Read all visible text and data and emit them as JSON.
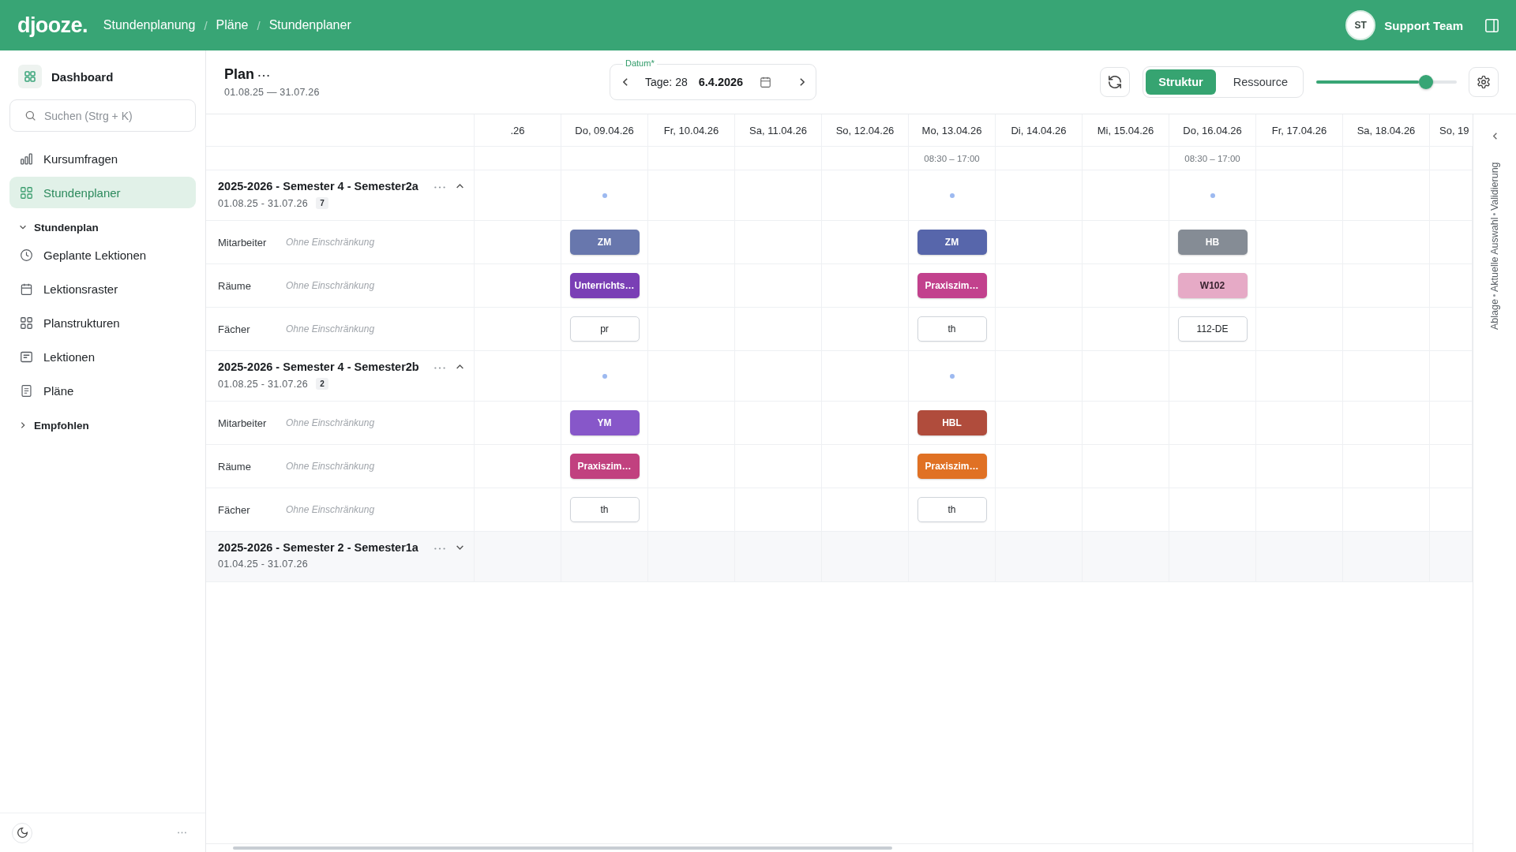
{
  "topbar": {
    "logo": "djooze.",
    "breadcrumb": [
      "Stundenplanung",
      "Pläne",
      "Stundenplaner"
    ],
    "separator": "/",
    "user": {
      "initials": "ST",
      "name": "Support Team"
    }
  },
  "sidebar": {
    "dashboard": "Dashboard",
    "search": {
      "placeholder": "Suchen (Strg + K)"
    },
    "items": [
      {
        "label": "Kursumfragen",
        "selected": false
      },
      {
        "label": "Stundenplaner",
        "selected": true
      }
    ],
    "sections": [
      {
        "label": "Stundenplan",
        "expanded": true,
        "children": [
          {
            "label": "Geplante Lektionen",
            "selected": false
          },
          {
            "label": "Lektionsraster",
            "selected": false
          },
          {
            "label": "Planstrukturen",
            "selected": false
          },
          {
            "label": "Lektionen",
            "selected": false
          },
          {
            "label": "Pläne",
            "selected": false
          }
        ]
      },
      {
        "label": "Empfohlen",
        "expanded": false
      }
    ]
  },
  "plan": {
    "title": "Plan",
    "dates": "01.08.25 — 31.07.26"
  },
  "date_picker": {
    "label": "Datum*",
    "days": "Tage: 28",
    "value": "6.4.2026"
  },
  "view_toggle": [
    {
      "label": "Struktur",
      "selected": true
    },
    {
      "label": "Ressource",
      "selected": false
    }
  ],
  "zoom_slider": {
    "level": 0.78
  },
  "grid": {
    "columns": [
      {
        "label": ".26"
      },
      {
        "label": "Do, 09.04.26"
      },
      {
        "label": "Fr, 10.04.26"
      },
      {
        "label": "Sa, 11.04.26"
      },
      {
        "label": "So, 12.04.26"
      },
      {
        "label": "Mo, 13.04.26",
        "hours": "08:30 – 17:00"
      },
      {
        "label": "Di, 14.04.26"
      },
      {
        "label": "Mi, 15.04.26"
      },
      {
        "label": "Do, 16.04.26",
        "hours": "08:30 – 17:00"
      },
      {
        "label": "Fr, 17.04.26"
      },
      {
        "label": "Sa, 18.04.26"
      },
      {
        "label": "So, 19"
      }
    ],
    "groups": [
      {
        "title": "2025-2026 - Semester 4 - Semester2a",
        "dates": "01.08.25 - 31.07.26",
        "count": "7",
        "expanded": true,
        "dots": [
          false,
          true,
          false,
          false,
          false,
          true,
          false,
          false,
          true,
          false,
          false,
          false
        ],
        "rows": [
          {
            "label": "Mitarbeiter",
            "filter": "Ohne Einschränkung",
            "cells": [
              null,
              {
                "kind": "filled",
                "text": "ZM",
                "color": "#6877ad"
              },
              null,
              null,
              null,
              {
                "kind": "filled",
                "text": "ZM",
                "color": "#5766ab"
              },
              null,
              null,
              {
                "kind": "filled",
                "text": "HB",
                "color": "#858c95"
              },
              null,
              null,
              null
            ]
          },
          {
            "label": "Räume",
            "filter": "Ohne Einschränkung",
            "cells": [
              null,
              {
                "kind": "filled",
                "text": "Unterrichts…",
                "color": "#7a3fb5"
              },
              null,
              null,
              null,
              {
                "kind": "filled",
                "text": "Praxiszim…",
                "color": "#c2418d"
              },
              null,
              null,
              {
                "kind": "filled",
                "text": "W102",
                "color": "#e6aac6"
              },
              null,
              null,
              null
            ]
          },
          {
            "label": "Fächer",
            "filter": "Ohne Einschränkung",
            "cells": [
              null,
              {
                "kind": "outline",
                "text": "pr"
              },
              null,
              null,
              null,
              {
                "kind": "outline",
                "text": "th"
              },
              null,
              null,
              {
                "kind": "outline",
                "text": "112-DE"
              },
              null,
              null,
              null
            ]
          }
        ]
      },
      {
        "title": "2025-2026 - Semester 4 - Semester2b",
        "dates": "01.08.25 - 31.07.26",
        "count": "2",
        "expanded": true,
        "dots": [
          false,
          true,
          false,
          false,
          false,
          true,
          false,
          false,
          false,
          false,
          false,
          false
        ],
        "rows": [
          {
            "label": "Mitarbeiter",
            "filter": "Ohne Einschränkung",
            "cells": [
              null,
              {
                "kind": "filled",
                "text": "YM",
                "color": "#8757c9"
              },
              null,
              null,
              null,
              {
                "kind": "filled",
                "text": "HBL",
                "color": "#b04c3c"
              },
              null,
              null,
              null,
              null,
              null,
              null
            ]
          },
          {
            "label": "Räume",
            "filter": "Ohne Einschränkung",
            "cells": [
              null,
              {
                "kind": "filled",
                "text": "Praxiszim…",
                "color": "#c1417f"
              },
              null,
              null,
              null,
              {
                "kind": "filled",
                "text": "Praxiszim…",
                "color": "#e07124"
              },
              null,
              null,
              null,
              null,
              null,
              null
            ]
          },
          {
            "label": "Fächer",
            "filter": "Ohne Einschränkung",
            "cells": [
              null,
              {
                "kind": "outline",
                "text": "th"
              },
              null,
              null,
              null,
              {
                "kind": "outline",
                "text": "th"
              },
              null,
              null,
              null,
              null,
              null,
              null
            ]
          }
        ]
      },
      {
        "title": "2025-2026 - Semester 2 - Semester1a",
        "dates": "01.04.25 - 31.07.26",
        "expanded": false
      }
    ]
  },
  "side_panel": {
    "tabs": [
      "Ablage",
      "Aktuelle Auswahl",
      "Validierung"
    ]
  }
}
